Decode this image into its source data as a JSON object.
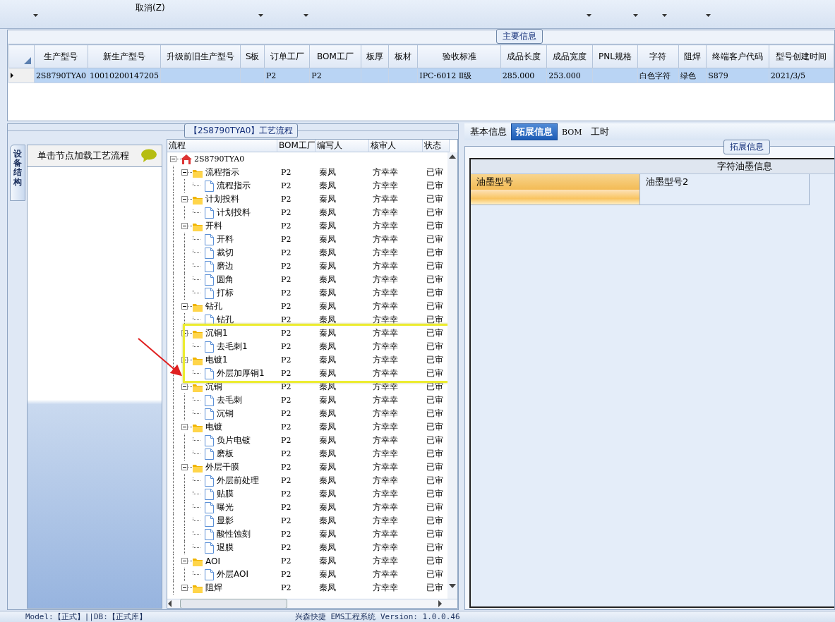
{
  "toolbar": {
    "menu_items": [
      {
        "label": "取消(Z)"
      }
    ]
  },
  "main_info": {
    "title": "主要信息",
    "columns": [
      "生产型号",
      "新生产型号",
      "升级前旧生产型号",
      "S板",
      "订单工厂",
      "BOM工厂",
      "板厚",
      "板材",
      "验收标准",
      "成品长度",
      "成品宽度",
      "PNL规格",
      "字符",
      "阻焊",
      "终端客户代码",
      "型号创建时间"
    ],
    "rows": [
      {
        "selected": true,
        "cells": [
          "2S8790TYA0",
          "10010200147205",
          "",
          "",
          "P2",
          "P2",
          "",
          "",
          "IPC-6012 Ⅱ级",
          "285.000",
          "253.000",
          "",
          "白色字符",
          "绿色",
          "S879",
          "2021/3/5"
        ]
      }
    ]
  },
  "process_panel": {
    "title": "【2S8790TYA0】工艺流程",
    "side_tab": "设备结构",
    "hint": "单击节点加载工艺流程",
    "tree": {
      "columns": [
        "流程",
        "BOM工厂",
        "编写人",
        "核审人",
        "状态"
      ],
      "root": {
        "label": "2S8790TYA0",
        "kind": "root",
        "expanded": true,
        "children": [
          {
            "label": "流程指示",
            "kind": "folder",
            "expanded": true,
            "cells": [
              "P2",
              "秦凤",
              "方幸幸",
              "已审"
            ],
            "children": [
              {
                "label": "流程指示",
                "kind": "file",
                "cells": [
                  "P2",
                  "秦凤",
                  "方幸幸",
                  "已审"
                ]
              }
            ]
          },
          {
            "label": "计划投料",
            "kind": "folder",
            "expanded": true,
            "cells": [
              "P2",
              "秦凤",
              "方幸幸",
              "已审"
            ],
            "children": [
              {
                "label": "计划投料",
                "kind": "file",
                "cells": [
                  "P2",
                  "秦凤",
                  "方幸幸",
                  "已审"
                ]
              }
            ]
          },
          {
            "label": "开料",
            "kind": "folder",
            "expanded": true,
            "cells": [
              "P2",
              "秦凤",
              "方幸幸",
              "已审"
            ],
            "children": [
              {
                "label": "开料",
                "kind": "file",
                "cells": [
                  "P2",
                  "秦凤",
                  "方幸幸",
                  "已审"
                ]
              },
              {
                "label": "裁切",
                "kind": "file",
                "cells": [
                  "P2",
                  "秦凤",
                  "方幸幸",
                  "已审"
                ]
              },
              {
                "label": "磨边",
                "kind": "file",
                "cells": [
                  "P2",
                  "秦凤",
                  "方幸幸",
                  "已审"
                ]
              },
              {
                "label": "圆角",
                "kind": "file",
                "cells": [
                  "P2",
                  "秦凤",
                  "方幸幸",
                  "已审"
                ]
              },
              {
                "label": "打标",
                "kind": "file",
                "cells": [
                  "P2",
                  "秦凤",
                  "方幸幸",
                  "已审"
                ]
              }
            ]
          },
          {
            "label": "钻孔",
            "kind": "folder",
            "expanded": true,
            "cells": [
              "P2",
              "秦凤",
              "方幸幸",
              "已审"
            ],
            "children": [
              {
                "label": "钻孔",
                "kind": "file",
                "cells": [
                  "P2",
                  "秦凤",
                  "方幸幸",
                  "已审"
                ]
              }
            ]
          },
          {
            "label": "沉铜1",
            "kind": "folder",
            "expanded": true,
            "cells": [
              "P2",
              "秦凤",
              "方幸幸",
              "已审"
            ],
            "children": [
              {
                "label": "去毛刺1",
                "kind": "file",
                "cells": [
                  "P2",
                  "秦凤",
                  "方幸幸",
                  "已审"
                ]
              }
            ]
          },
          {
            "label": "电镀1",
            "kind": "folder",
            "expanded": true,
            "cells": [
              "P2",
              "秦凤",
              "方幸幸",
              "已审"
            ],
            "children": [
              {
                "label": "外层加厚铜1",
                "kind": "file",
                "cells": [
                  "P2",
                  "秦凤",
                  "方幸幸",
                  "已审"
                ]
              }
            ]
          },
          {
            "label": "沉铜",
            "kind": "folder",
            "expanded": true,
            "cells": [
              "P2",
              "秦凤",
              "方幸幸",
              "已审"
            ],
            "children": [
              {
                "label": "去毛刺",
                "kind": "file",
                "cells": [
                  "P2",
                  "秦凤",
                  "方幸幸",
                  "已审"
                ]
              },
              {
                "label": "沉铜",
                "kind": "file",
                "cells": [
                  "P2",
                  "秦凤",
                  "方幸幸",
                  "已审"
                ]
              }
            ]
          },
          {
            "label": "电镀",
            "kind": "folder",
            "expanded": true,
            "cells": [
              "P2",
              "秦凤",
              "方幸幸",
              "已审"
            ],
            "children": [
              {
                "label": "负片电镀",
                "kind": "file",
                "cells": [
                  "P2",
                  "秦凤",
                  "方幸幸",
                  "已审"
                ]
              },
              {
                "label": "磨板",
                "kind": "file",
                "cells": [
                  "P2",
                  "秦凤",
                  "方幸幸",
                  "已审"
                ]
              }
            ]
          },
          {
            "label": "外层干膜",
            "kind": "folder",
            "expanded": true,
            "cells": [
              "P2",
              "秦凤",
              "方幸幸",
              "已审"
            ],
            "children": [
              {
                "label": "外层前处理",
                "kind": "file",
                "cells": [
                  "P2",
                  "秦凤",
                  "方幸幸",
                  "已审"
                ]
              },
              {
                "label": "贴膜",
                "kind": "file",
                "cells": [
                  "P2",
                  "秦凤",
                  "方幸幸",
                  "已审"
                ]
              },
              {
                "label": "曝光",
                "kind": "file",
                "cells": [
                  "P2",
                  "秦凤",
                  "方幸幸",
                  "已审"
                ]
              },
              {
                "label": "显影",
                "kind": "file",
                "cells": [
                  "P2",
                  "秦凤",
                  "方幸幸",
                  "已审"
                ]
              },
              {
                "label": "酸性蚀刻",
                "kind": "file",
                "cells": [
                  "P2",
                  "秦凤",
                  "方幸幸",
                  "已审"
                ]
              },
              {
                "label": "退膜",
                "kind": "file",
                "cells": [
                  "P2",
                  "秦凤",
                  "方幸幸",
                  "已审"
                ]
              }
            ]
          },
          {
            "label": "AOI",
            "kind": "folder",
            "expanded": true,
            "cells": [
              "P2",
              "秦凤",
              "方幸幸",
              "已审"
            ],
            "children": [
              {
                "label": "外层AOI",
                "kind": "file",
                "cells": [
                  "P2",
                  "秦凤",
                  "方幸幸",
                  "已审"
                ]
              }
            ]
          },
          {
            "label": "阻焊",
            "kind": "folder",
            "expanded": true,
            "cells": [
              "P2",
              "秦凤",
              "方幸幸",
              "已审"
            ]
          }
        ]
      }
    }
  },
  "detail_panel": {
    "tabs": [
      {
        "label": "基本信息",
        "selected": false
      },
      {
        "label": "拓展信息",
        "selected": true
      },
      {
        "label": "BOM",
        "selected": false
      },
      {
        "label": "工时",
        "selected": false
      }
    ],
    "group_title": "拓展信息",
    "grid": {
      "header": "字符油墨信息",
      "rows": [
        {
          "label": "油墨型号",
          "value": "油墨型号2"
        }
      ]
    }
  },
  "status_bar": {
    "left": "Model:【正式】||DB:【正式库】",
    "center": "兴森快捷 EMS工程系统 Version: 1.0.0.46"
  }
}
